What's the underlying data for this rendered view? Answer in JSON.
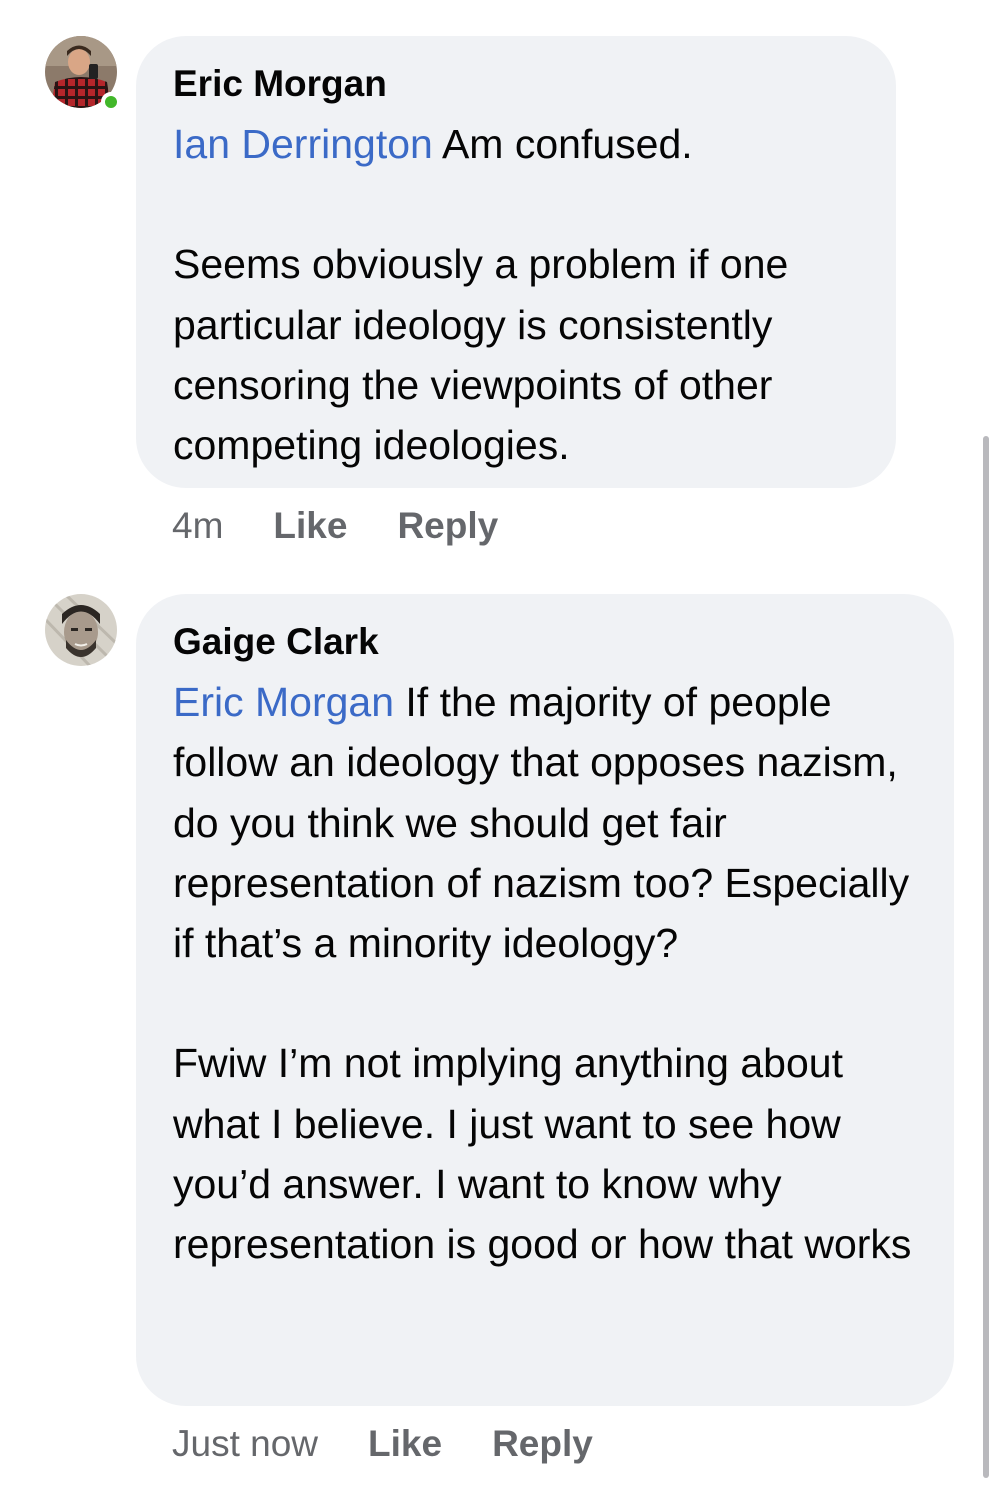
{
  "comments": [
    {
      "author": "Eric Morgan",
      "mention": "Ian Derrington",
      "first_line_rest": " Am confused.",
      "paragraph2": "Seems obviously a problem if one particular ideology is consistently censoring the viewpoints of other competing ideologies.",
      "time": "4m",
      "like_label": "Like",
      "reply_label": "Reply",
      "online": true
    },
    {
      "author": "Gaige Clark",
      "mention": "Eric Morgan",
      "first_line_rest": " If the majority of people follow an ideology that opposes nazism, do you think we should get fair representation of nazism too? Especially if that’s a minority ideology?",
      "paragraph2": "Fwiw I’m not implying anything about what I believe. I just want to see how you’d answer. I want to know why representation is good or how that works",
      "time": "Just now",
      "like_label": "Like",
      "reply_label": "Reply",
      "online": false
    }
  ],
  "colors": {
    "bubble": "#f0f2f5",
    "mention": "#3b6ac7",
    "meta": "#65676b",
    "online": "#42b72a"
  },
  "icons": [
    "avatar-eric-morgan",
    "avatar-gaige-clark",
    "online-status-icon"
  ]
}
